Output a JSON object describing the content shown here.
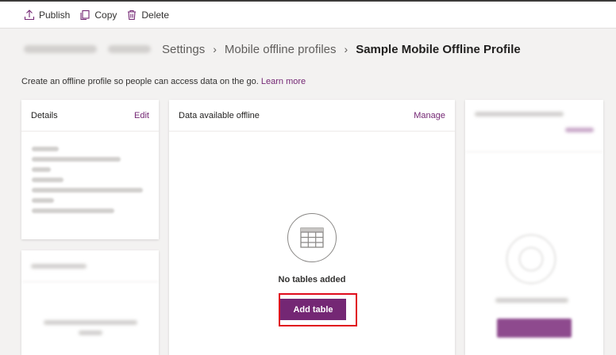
{
  "command_bar": {
    "publish_label": "Publish",
    "copy_label": "Copy",
    "delete_label": "Delete"
  },
  "breadcrumb": {
    "settings": "Settings",
    "profiles": "Mobile offline profiles",
    "current": "Sample Mobile Offline Profile"
  },
  "intro": {
    "text": "Create an offline profile so people can access data on the go.",
    "link": "Learn more"
  },
  "details_card": {
    "title": "Details",
    "edit_label": "Edit"
  },
  "data_card": {
    "title": "Data available offline",
    "manage_label": "Manage",
    "empty_text": "No tables added",
    "add_button": "Add table"
  },
  "colors": {
    "accent": "#742774",
    "highlight": "#e00b1c"
  }
}
